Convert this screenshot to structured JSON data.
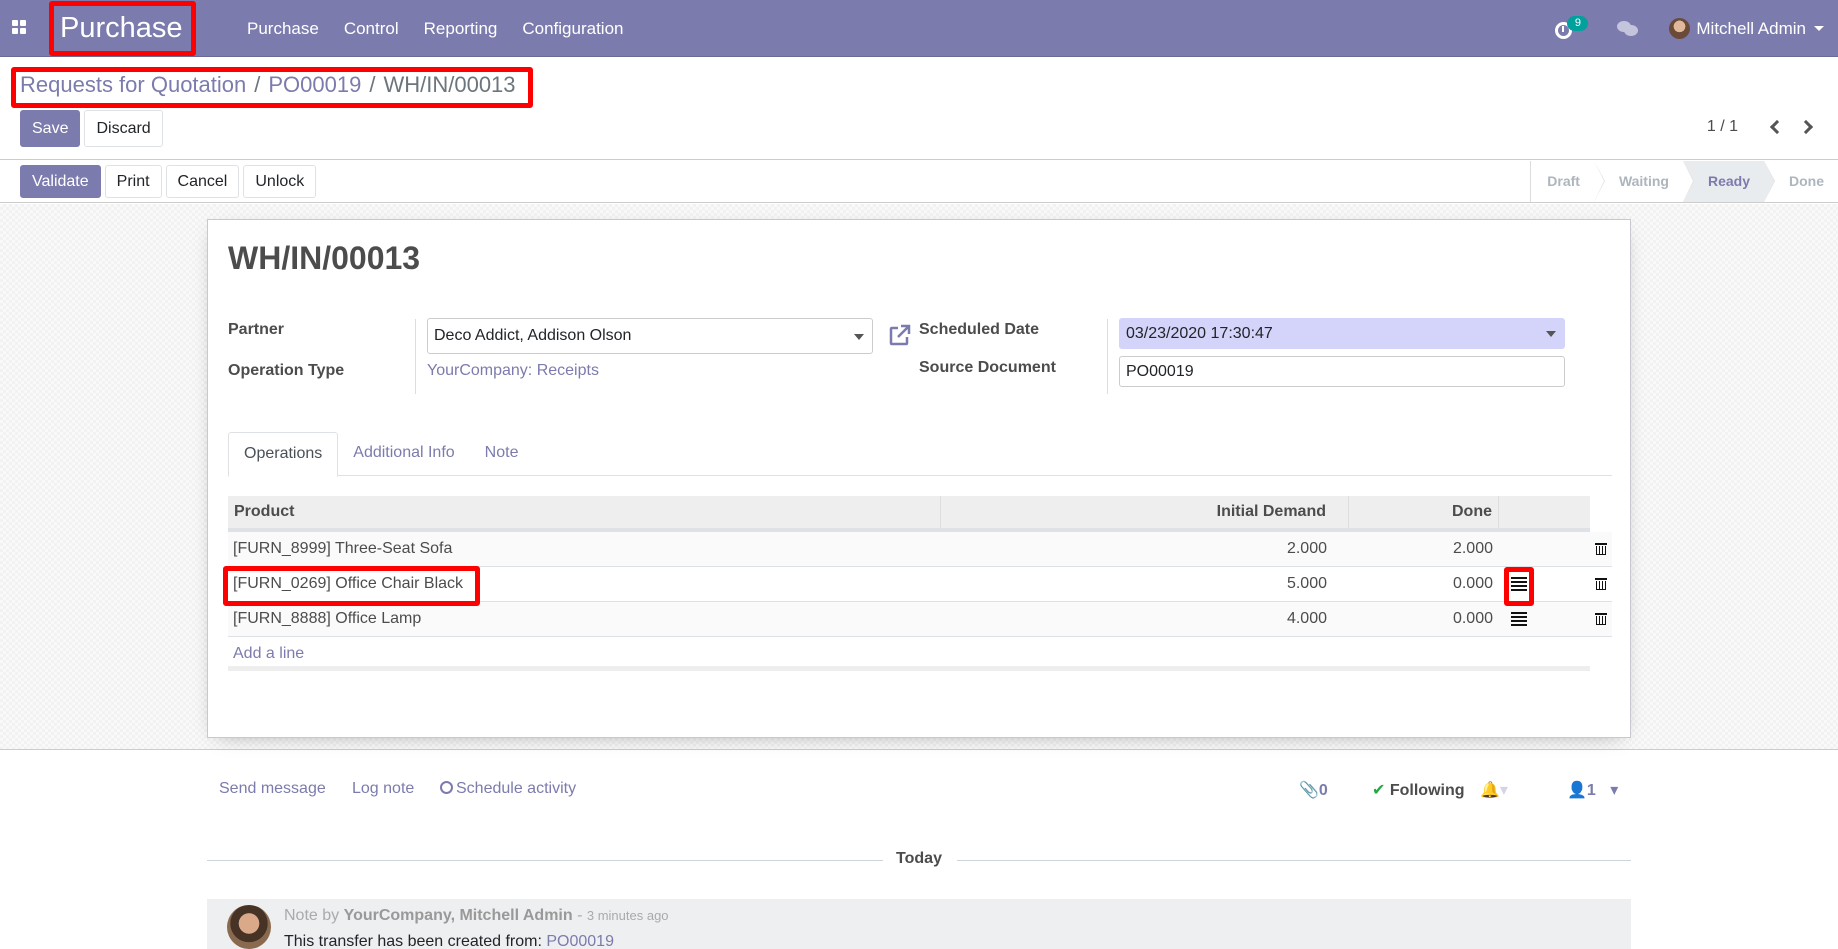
{
  "navbar": {
    "app_name": "Purchase",
    "menu": [
      "Purchase",
      "Control",
      "Reporting",
      "Configuration"
    ],
    "activity_count": "9",
    "user_name": "Mitchell Admin"
  },
  "breadcrumb": {
    "items": [
      "Requests for Quotation",
      "PO00019"
    ],
    "current": "WH/IN/00013",
    "separator": "/"
  },
  "control_panel": {
    "save_label": "Save",
    "discard_label": "Discard",
    "pager_value": "1 / 1"
  },
  "statusbar": {
    "buttons": [
      "Validate",
      "Print",
      "Cancel",
      "Unlock"
    ],
    "steps": [
      "Draft",
      "Waiting",
      "Ready",
      "Done"
    ],
    "current_step": "Ready"
  },
  "form": {
    "title": "WH/IN/00013",
    "fields": {
      "partner_label": "Partner",
      "partner_value": "Deco Addict, Addison Olson",
      "operation_type_label": "Operation Type",
      "operation_type_value": "YourCompany: Receipts",
      "scheduled_date_label": "Scheduled Date",
      "scheduled_date_value": "03/23/2020 17:30:47",
      "source_document_label": "Source Document",
      "source_document_value": "PO00019"
    },
    "tabs": [
      "Operations",
      "Additional Info",
      "Note"
    ],
    "active_tab": "Operations",
    "table": {
      "columns": [
        "Product",
        "Initial Demand",
        "Done"
      ],
      "rows": [
        {
          "product": "[FURN_8999] Three-Seat Sofa",
          "initial_demand": "2.000",
          "done": "2.000",
          "has_detail": false
        },
        {
          "product": "[FURN_0269] Office Chair Black",
          "initial_demand": "5.000",
          "done": "0.000",
          "has_detail": true
        },
        {
          "product": "[FURN_8888] Office Lamp",
          "initial_demand": "4.000",
          "done": "0.000",
          "has_detail": true
        }
      ],
      "add_line_label": "Add a line"
    }
  },
  "chatter": {
    "send_message": "Send message",
    "log_note": "Log note",
    "schedule_activity": "Schedule activity",
    "attachments_count": "0",
    "following_label": "Following",
    "followers_count": "1",
    "today_label": "Today",
    "message": {
      "prefix": "Note by",
      "author": "YourCompany, Mitchell Admin",
      "dash": "-",
      "time": "3 minutes ago",
      "body": "This transfer has been created from:",
      "link": "PO00019"
    }
  },
  "colors": {
    "brand": "#7c7bad",
    "highlight": "#ff0000",
    "badge": "#00a09d",
    "following_check": "#28a745"
  }
}
